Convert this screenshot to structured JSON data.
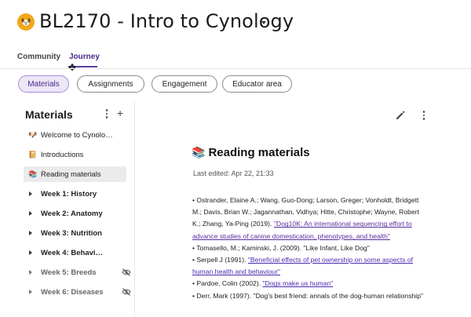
{
  "course": {
    "icon": "dog-face-icon",
    "title": "BL2170 - Intro to Cynology",
    "accent_color": "#5b3fa5",
    "icon_color": "#f2a81d"
  },
  "tabs": [
    {
      "label": "Community",
      "active": false
    },
    {
      "label": "Journey",
      "active": true
    }
  ],
  "pills": [
    {
      "label": "Materials",
      "active": true
    },
    {
      "label": "Assignments",
      "active": false
    },
    {
      "label": "Engagement",
      "active": false
    },
    {
      "label": "Educator area",
      "active": false
    }
  ],
  "sidebar": {
    "title": "Materials",
    "add_symbol": "+",
    "pages": [
      {
        "emoji": "🐶",
        "label": "Welcome to Cynolo…",
        "selected": false
      },
      {
        "emoji": "📔",
        "label": "Introductions",
        "selected": false
      },
      {
        "emoji": "📚",
        "label": "Reading materials",
        "selected": true
      }
    ],
    "weeks": [
      {
        "label": "Week 1: History",
        "hidden": false
      },
      {
        "label": "Week 2: Anatomy",
        "hidden": false
      },
      {
        "label": "Week 3: Nutrition",
        "hidden": false
      },
      {
        "label": "Week 4: Behavi…",
        "hidden": false
      },
      {
        "label": "Week 5: Breeds",
        "hidden": true
      },
      {
        "label": "Week 6: Diseases",
        "hidden": true
      }
    ]
  },
  "content": {
    "heading_emoji": "📚",
    "heading": "Reading materials",
    "last_edited": "Last edited: Apr 22, 21:33",
    "references": [
      {
        "bullet": "•",
        "text": " Ostrander, Elaine A.; Wang, Guo-Dong; Larson, Greger; Vonholdt, Bridgett M.; Davis, Brian W.; Jagannathan, Vidhya; Hitte, Christophe; Wayne, Robert K.; Zhang, Ya-Ping (2019). ",
        "link": "\"Dog10K: An international sequencing effort to advance studies of canine domestication, phenotypes, and health\"",
        "after": ""
      },
      {
        "bullet": "•",
        "text": " Tomasello, M.; Kaminski, J. (2009). \"Like Infant, Like Dog\"",
        "link": "",
        "after": ""
      },
      {
        "bullet": "•",
        "text": " Serpell J (1991). ",
        "link": "\"Beneficial effects of pet ownership on some aspects of human health and behaviour\"",
        "after": ""
      },
      {
        "bullet": "•",
        "text": " Pardoe, Colin (2002). ",
        "link": "\"Dogs make us human\"",
        "after": ""
      },
      {
        "bullet": "•",
        "text": " Derr, Mark (1997). \"Dog's best friend: annals of the dog-human relationship\"",
        "link": "",
        "after": ""
      }
    ]
  }
}
